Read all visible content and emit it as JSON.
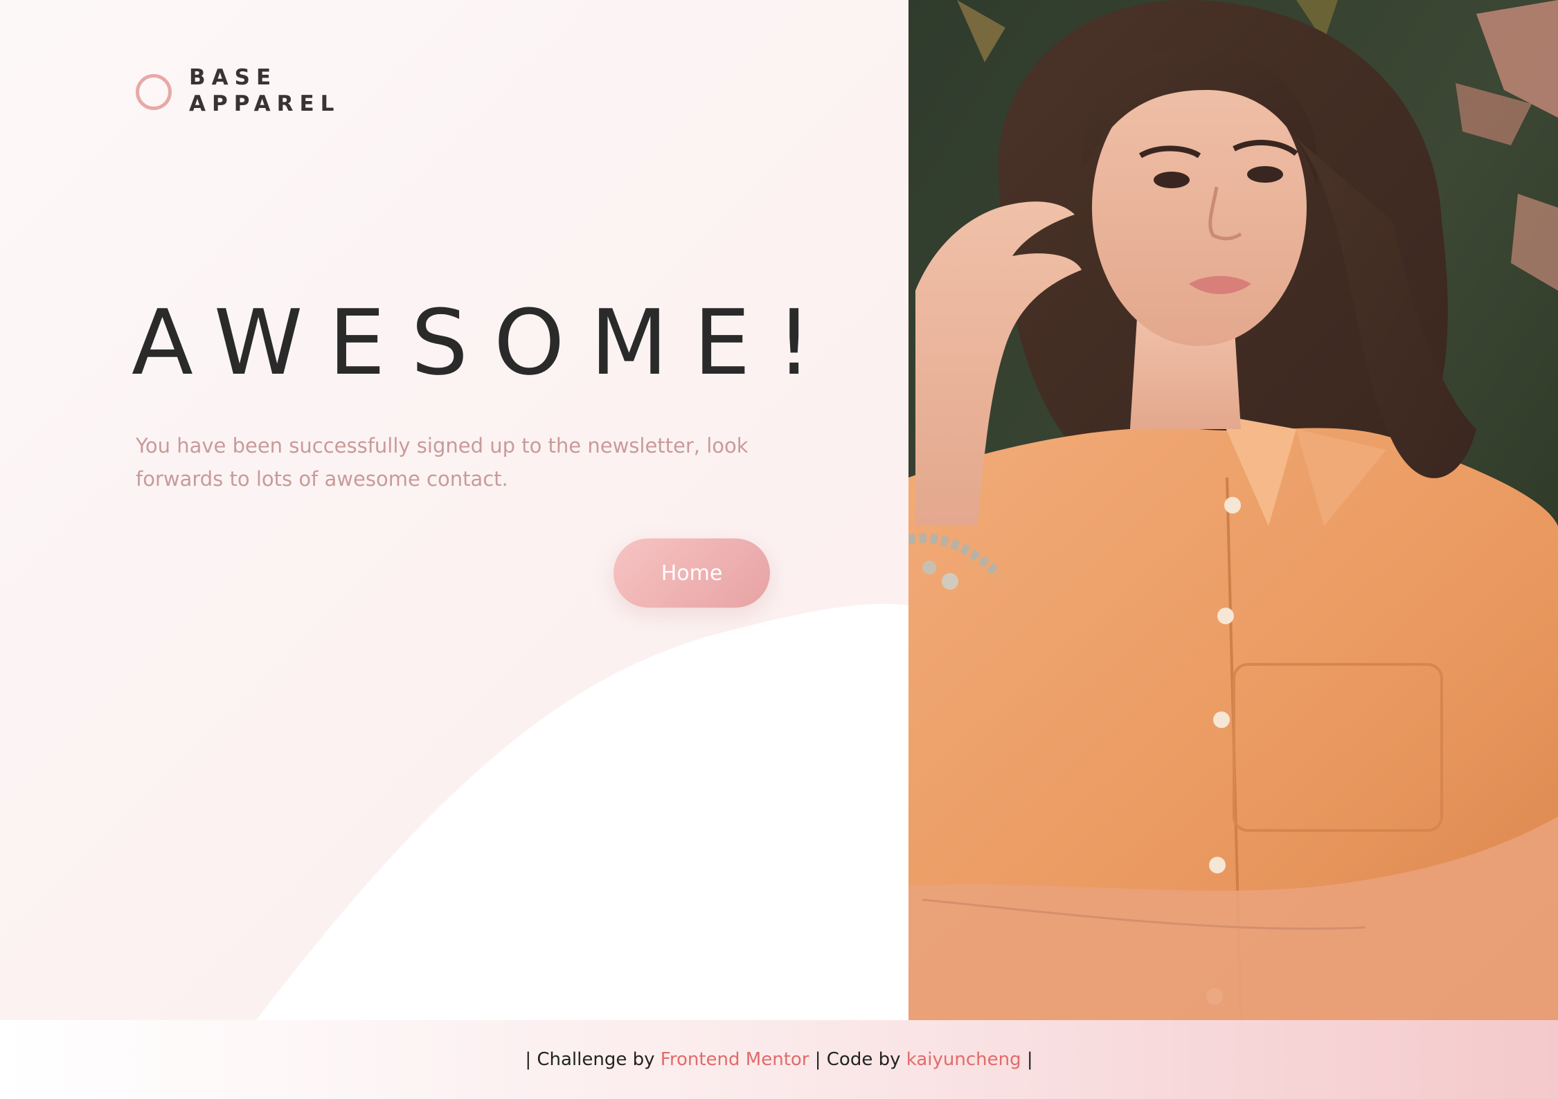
{
  "brand": {
    "line1": "BASE",
    "line2": "APPAREL",
    "accent": "#e7a9a8"
  },
  "hero": {
    "headline": "AWESOME!",
    "message": "You have been successfully signed up to the newsletter, look forwards to lots of awesome contact.",
    "home_button": "Home"
  },
  "footer": {
    "sep_start": "| Challenge by ",
    "challenge_link": "Frontend Mentor",
    "sep_mid": " | Code by ",
    "author_link": "kaiyuncheng",
    "sep_end": " |",
    "link_color": "#e26a6a"
  },
  "colors": {
    "headline": "#2a2a2a",
    "message": "#c99a9a",
    "button_from": "#f7c3c3",
    "button_to": "#e7a3a4"
  }
}
